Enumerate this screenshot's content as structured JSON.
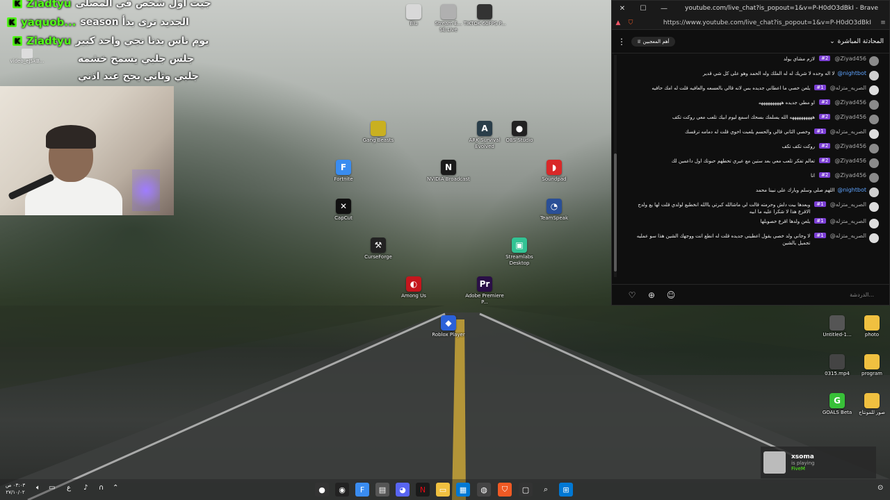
{
  "overlay": {
    "lines": [
      {
        "platform": "K",
        "user": "Ziadtyu",
        "message": "جيت اول شخص في المصلى"
      },
      {
        "platform": "K",
        "user": "yaquob...",
        "message": "season الجديد ترى بدأ"
      },
      {
        "platform": "K",
        "user": "Ziadtyu",
        "message": "يوم ناس بدنا نجي واحد كبير"
      },
      {
        "platform": "",
        "user": "",
        "message": "جلس جلبي يسمح خشمه"
      },
      {
        "platform": "",
        "user": "",
        "message": "جلبي وثاني يحج عند اذني"
      }
    ],
    "file_label": "video_eJSkB..."
  },
  "desktop_icons": [
    {
      "name": "blu-icon",
      "label": "Blu",
      "color": "#d8d8d8",
      "glyph": ""
    },
    {
      "name": "streamelements-icon",
      "label": "Stream E... SE.Live",
      "color": "#b0b0b0",
      "glyph": ""
    },
    {
      "name": "tiktok-icon",
      "label": "TIKTOK 60FPS P...",
      "color": "#333",
      "glyph": ""
    },
    {
      "name": "gang-beasts-icon",
      "label": "Gang Beasts",
      "color": "#c9b020",
      "glyph": ""
    },
    {
      "name": "ark-icon",
      "label": "ARK Survival Evolved",
      "color": "#2a3e4a",
      "glyph": "A"
    },
    {
      "name": "obs-icon",
      "label": "OBS Studio",
      "color": "#222",
      "glyph": "●"
    },
    {
      "name": "fortnite-icon",
      "label": "Fortnite",
      "color": "#3a8cf0",
      "glyph": "F"
    },
    {
      "name": "nvidia-icon",
      "label": "NVIDIA Broadcast",
      "color": "#1a1a1a",
      "glyph": "N"
    },
    {
      "name": "soundpad-icon",
      "label": "Soundpad",
      "color": "#d92828",
      "glyph": "◗"
    },
    {
      "name": "capcut-icon",
      "label": "CapCut",
      "color": "#111",
      "glyph": "✕"
    },
    {
      "name": "teamspeak-icon",
      "label": "TeamSpeak",
      "color": "#2a4f96",
      "glyph": "◔"
    },
    {
      "name": "curseforge-icon",
      "label": "CurseForge",
      "color": "#222",
      "glyph": "⚒"
    },
    {
      "name": "streamlabs-icon",
      "label": "Streamlabs Desktop",
      "color": "#32c394",
      "glyph": "▣"
    },
    {
      "name": "among-us-icon",
      "label": "Among Us",
      "color": "#c5161d",
      "glyph": "◐"
    },
    {
      "name": "premiere-icon",
      "label": "Adobe Premiere P...",
      "color": "#2a0f46",
      "glyph": "Pr"
    },
    {
      "name": "roblox-icon",
      "label": "Roblox Player",
      "color": "#2b61d9",
      "glyph": "◆"
    },
    {
      "name": "untitled-icon",
      "label": "Untitled-1...",
      "color": "#555",
      "glyph": ""
    },
    {
      "name": "photo-folder-icon",
      "label": "photo",
      "color": "#f0c040",
      "glyph": ""
    },
    {
      "name": "video-file-icon",
      "label": "0315.mp4",
      "color": "#444",
      "glyph": ""
    },
    {
      "name": "program-folder-icon",
      "label": "program",
      "color": "#f0c040",
      "glyph": ""
    },
    {
      "name": "goals-icon",
      "label": "GOALS Beta",
      "color": "#38c038",
      "glyph": "G"
    },
    {
      "name": "montage-folder-icon",
      "label": "صور للمونتاج",
      "color": "#f0c040",
      "glyph": ""
    }
  ],
  "chat": {
    "window_title": "youtube.com/live_chat?is_popout=1&v=P-H0dO3dBkI - Brave",
    "url": "https://www.youtube.com/live_chat?is_popout=1&v=P-H0dO3dBkI",
    "header_title": "المحادثة المباشرة",
    "top_fans_pill": "أهم المعجبين",
    "input_placeholder": "الدردشة...",
    "messages": [
      {
        "author": "@Ziyad456",
        "badge": "#2",
        "text": "لازم مشاي يولد",
        "bot": false,
        "avatar": "#8a8a8a"
      },
      {
        "author": "@nightbot",
        "badge": "",
        "text": "لا اله وحده لا شريك له له الملك وله الحمد وهو على كل شي قدير",
        "bot": true,
        "avatar": "#cfcfcf"
      },
      {
        "author": "@الصريه_متزله",
        "badge": "#1",
        "text": "يلعن خصي ما اعطاني جديده بس لانه قالي بالعسعه والعافيه قلت له امك حافيه",
        "bot": false,
        "avatar": "#dddddd"
      },
      {
        "author": "@Ziyad456",
        "badge": "#2",
        "text": "او مطي جديده ههههههههههه",
        "bot": false,
        "avatar": "#8a8a8a"
      },
      {
        "author": "@Ziyad456",
        "badge": "#2",
        "text": "ههههههههههه الله يسلمك بسحك اسمع ليوم ابيك تلعب معي روكت تكف",
        "bot": false,
        "avatar": "#8a8a8a"
      },
      {
        "author": "@الصريه_متزله",
        "badge": "#1",
        "text": "وخصي الثاني قالي والحسم يلعبت اخوي قلت له دمامه ترقسك",
        "bot": false,
        "avatar": "#dddddd"
      },
      {
        "author": "@Ziyad456",
        "badge": "#2",
        "text": "روكت تكف تكف",
        "bot": false,
        "avatar": "#8a8a8a"
      },
      {
        "author": "@Ziyad456",
        "badge": "#2",
        "text": "تعالم تفكر تلعب معي بعد ستين مع عيري تحطهم حبونك اول داعمين لك",
        "bot": false,
        "avatar": "#8a8a8a"
      },
      {
        "author": "@Ziyad456",
        "badge": "#2",
        "text": "انا",
        "bot": false,
        "avatar": "#8a8a8a"
      },
      {
        "author": "@nightbot",
        "badge": "",
        "text": "اللهم صلي وسلم وبارك على نبينا محمد",
        "bot": true,
        "avatar": "#cfcfcf"
      },
      {
        "author": "@الصريه_متزله",
        "badge": "#1",
        "text": "وبعدها بيت دلش وحرمته قالت لي ماشالله كبرتي ياالله انخطبع لولدي قلت لها يع ولدج الاقرع هذا لا شكرا عليه ما ابيه",
        "bot": false,
        "avatar": "#dddddd"
      },
      {
        "author": "@الصريه_متزله",
        "badge": "#1",
        "text": "يلعن ولدها اقرع خصوبلها",
        "bot": false,
        "avatar": "#dddddd"
      },
      {
        "author": "@الصريه_متزله",
        "badge": "#1",
        "text": "لا وجاني ولد خصي يقول اعطيني جديده قلت له انطع انت ووجهك الشين هذا سو عمليه تجميل يالشين",
        "bot": false,
        "avatar": "#dddddd"
      }
    ]
  },
  "notification": {
    "name": "xsoma",
    "status": "is playing",
    "game": "FiveM"
  },
  "taskbar": {
    "time": "٠٣:٠٣ ص",
    "date": "٢٧/١٠/٠٢"
  }
}
